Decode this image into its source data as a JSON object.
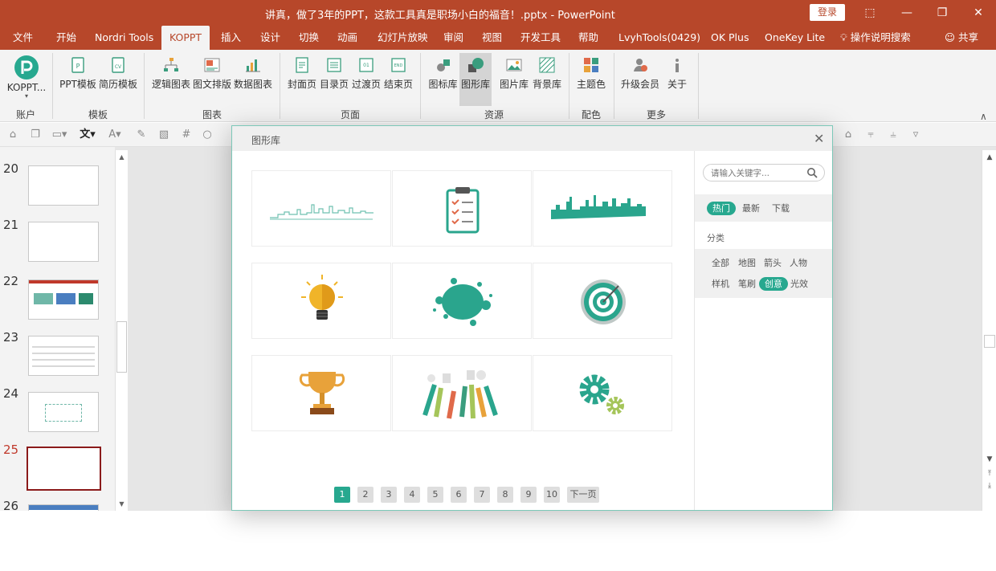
{
  "window": {
    "title": "讲真，做了3年的PPT，这款工具真是职场小白的福音！.pptx  -  PowerPoint",
    "login_label": "登录"
  },
  "tabs": [
    "文件",
    "开始",
    "Nordri Tools",
    "KOPPT",
    "插入",
    "设计",
    "切换",
    "动画",
    "幻灯片放映",
    "审阅",
    "视图",
    "开发工具",
    "帮助",
    "LvyhTools(0429)",
    "OK Plus",
    "OneKey Lite"
  ],
  "active_tab": "KOPPT",
  "tell_me": "操作说明搜索",
  "share": "共享",
  "ribbon": {
    "koppt_label": "KOPPT...",
    "buttons": {
      "ppt_template": "PPT模板",
      "resume_template": "简历模板",
      "logic_chart": "逻辑图表",
      "image_text": "图文排版",
      "data_chart": "数据图表",
      "cover": "封面页",
      "toc": "目录页",
      "transition": "过渡页",
      "end": "结束页",
      "icon_lib": "图标库",
      "shape_lib": "图形库",
      "image_lib": "图片库",
      "bg_lib": "背景库",
      "theme_color": "主题色",
      "upgrade": "升级会员",
      "about": "关于"
    },
    "groups": {
      "account": "账户",
      "template": "模板",
      "chart": "图表",
      "page": "页面",
      "resource": "资源",
      "color": "配色",
      "more": "更多"
    }
  },
  "slides": {
    "numbers": [
      "20",
      "21",
      "22",
      "23",
      "24",
      "25",
      "26"
    ],
    "current": "25"
  },
  "dialog": {
    "title": "图形库",
    "search_placeholder": "请输入关键字...",
    "sort_tabs": [
      "热门",
      "最新",
      "下载"
    ],
    "active_sort": "热门",
    "category_label": "分类",
    "categories_row1": [
      "全部",
      "地图",
      "箭头",
      "人物"
    ],
    "categories_row2": [
      "样机",
      "笔刷",
      "创意",
      "光效"
    ],
    "active_category": "创意",
    "pages": [
      "1",
      "2",
      "3",
      "4",
      "5",
      "6",
      "7",
      "8",
      "9",
      "10"
    ],
    "current_page": "1",
    "next_page": "下一页",
    "items": [
      "skyline-line-icon",
      "clipboard-checklist-icon",
      "skyline-silhouette-icon",
      "lightbulb-icon",
      "paint-splash-icon",
      "target-icon",
      "trophy-icon",
      "raised-hands-icon",
      "gears-icon"
    ]
  },
  "colors": {
    "brand": "#b7472a",
    "accent": "#27a88f"
  }
}
